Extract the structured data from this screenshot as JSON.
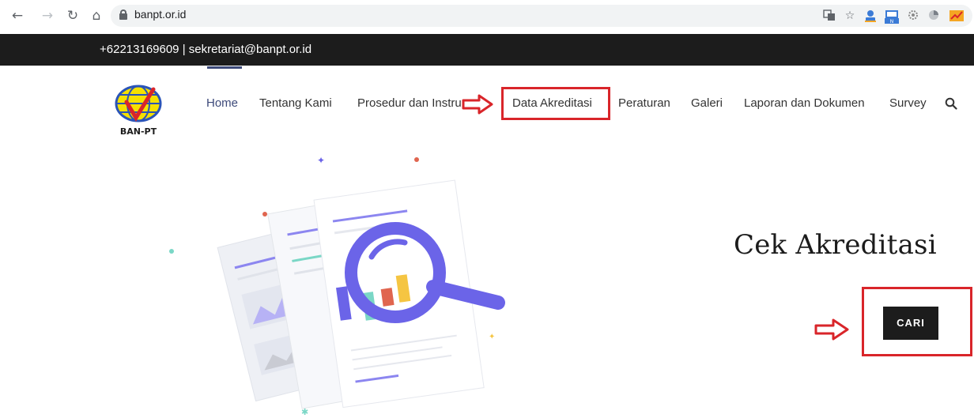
{
  "browser": {
    "url": "banpt.or.id"
  },
  "topbar": {
    "contact": "+62213169609 | sekretariat@banpt.or.id"
  },
  "logo": {
    "text": "BAN-PT"
  },
  "nav": {
    "items": [
      {
        "label": "Home",
        "active": true
      },
      {
        "label": "Tentang Kami"
      },
      {
        "label": "Prosedur dan Instrumen"
      },
      {
        "label": "Data Akreditasi"
      },
      {
        "label": "Peraturan"
      },
      {
        "label": "Galeri"
      },
      {
        "label": "Laporan dan Dokumen"
      },
      {
        "label": "Survey"
      }
    ],
    "search_icon": "search-icon"
  },
  "hero": {
    "title": "Cek Akreditasi",
    "button_label": "CARI"
  },
  "colors": {
    "topbar_bg": "#1c1c1c",
    "nav_active": "#3d4a7a",
    "annotation": "#d9252a",
    "magnifier": "#6b64e8",
    "button_bg": "#1c1c1c"
  }
}
